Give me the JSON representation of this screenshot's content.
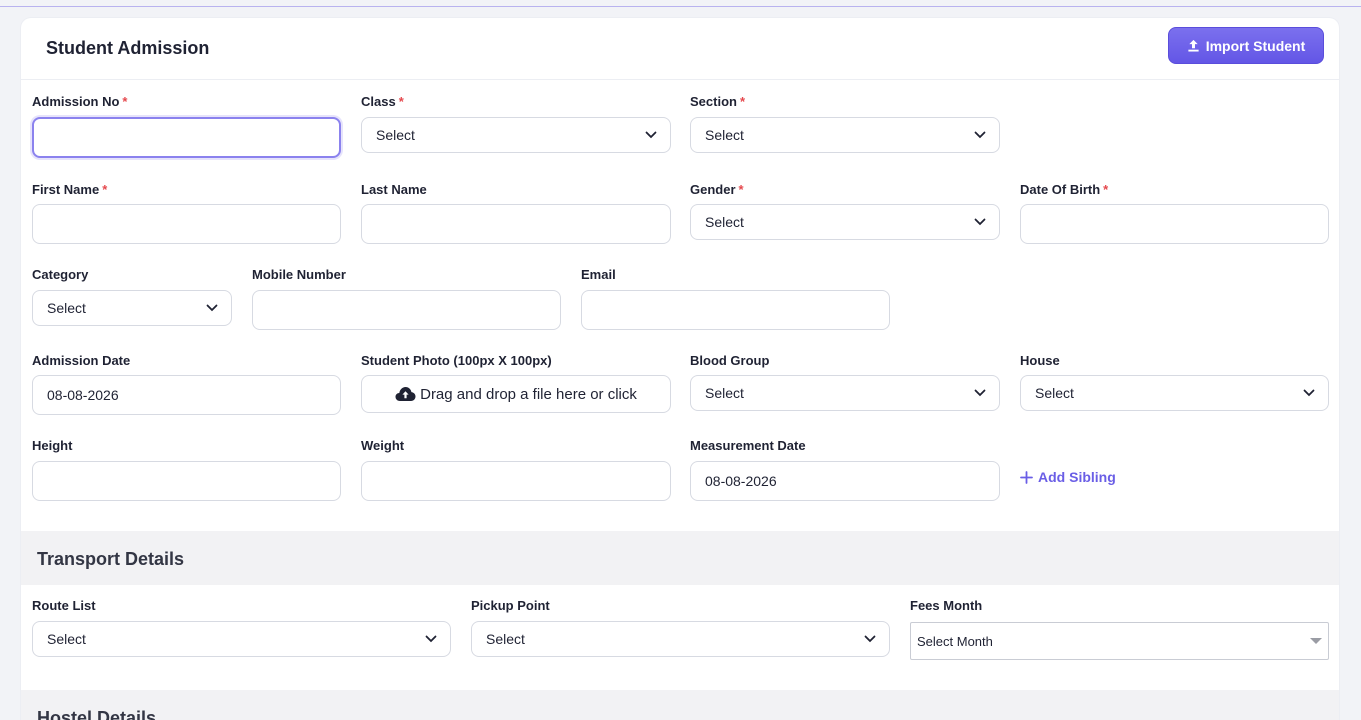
{
  "header": {
    "title": "Student Admission",
    "import_label": "Import Student"
  },
  "form": {
    "admission_no": {
      "label": "Admission No",
      "value": ""
    },
    "class": {
      "label": "Class",
      "value": "Select"
    },
    "section": {
      "label": "Section",
      "value": "Select"
    },
    "first_name": {
      "label": "First Name",
      "value": ""
    },
    "last_name": {
      "label": "Last Name",
      "value": ""
    },
    "gender": {
      "label": "Gender",
      "value": "Select"
    },
    "dob": {
      "label": "Date Of Birth",
      "value": ""
    },
    "category": {
      "label": "Category",
      "value": "Select"
    },
    "mobile": {
      "label": "Mobile Number",
      "value": ""
    },
    "email": {
      "label": "Email",
      "value": ""
    },
    "admission_date": {
      "label": "Admission Date",
      "value": "08-08-2026"
    },
    "photo": {
      "label": "Student Photo (100px X 100px)",
      "value": "Drag and drop a file here or click"
    },
    "blood_group": {
      "label": "Blood Group",
      "value": "Select"
    },
    "house": {
      "label": "House",
      "value": "Select"
    },
    "height": {
      "label": "Height",
      "value": ""
    },
    "weight": {
      "label": "Weight",
      "value": ""
    },
    "measurement_date": {
      "label": "Measurement Date",
      "value": "08-08-2026"
    },
    "add_sibling_label": "Add Sibling",
    "required_mark": "*"
  },
  "transport": {
    "title": "Transport Details",
    "route_list": {
      "label": "Route List",
      "value": "Select"
    },
    "pickup_point": {
      "label": "Pickup Point",
      "value": "Select"
    },
    "fees_month": {
      "label": "Fees Month",
      "value": "Select Month"
    }
  },
  "hostel": {
    "title": "Hostel Details"
  },
  "colors": {
    "accent": "#6356e6",
    "required": "#e5484d",
    "section_band": "#f2f2f4"
  }
}
